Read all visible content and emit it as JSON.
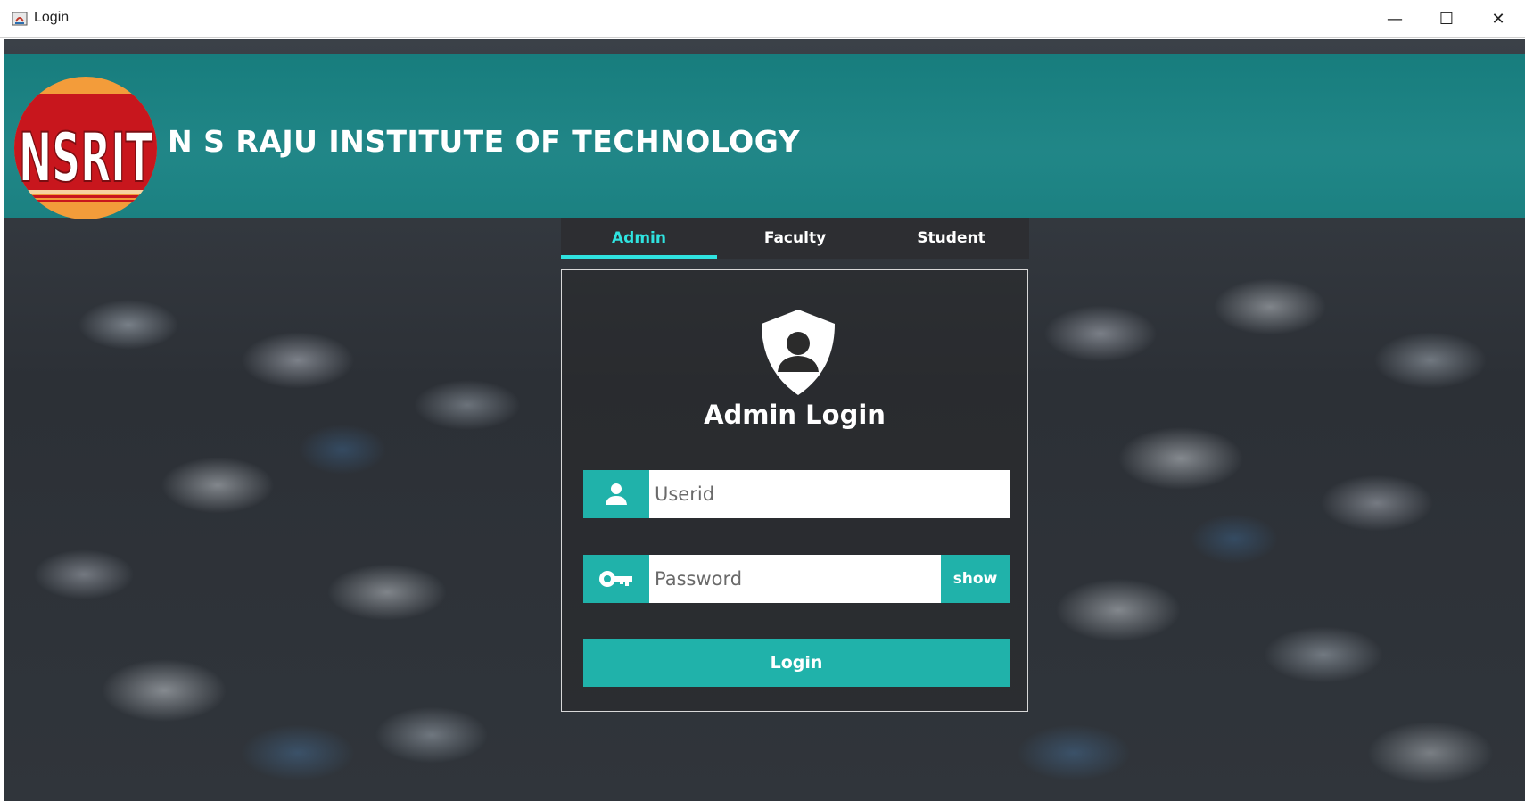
{
  "window": {
    "title": "Login",
    "controls": {
      "minimize": "—",
      "maximize": "☐",
      "close": "✕"
    }
  },
  "header": {
    "logo_text": "NSRIT",
    "institute_name": "N S RAJU INSTITUTE OF TECHNOLOGY"
  },
  "tabs": [
    {
      "label": "Admin",
      "active": true
    },
    {
      "label": "Faculty",
      "active": false
    },
    {
      "label": "Student",
      "active": false
    }
  ],
  "login": {
    "title": "Admin Login",
    "userid_placeholder": "Userid",
    "password_placeholder": "Password",
    "show_label": "show",
    "login_label": "Login"
  },
  "colors": {
    "accent": "#20b2aa",
    "tab_active": "#2fe3e0",
    "header_band": "#1a8c8c",
    "logo_red": "#c8161d"
  }
}
